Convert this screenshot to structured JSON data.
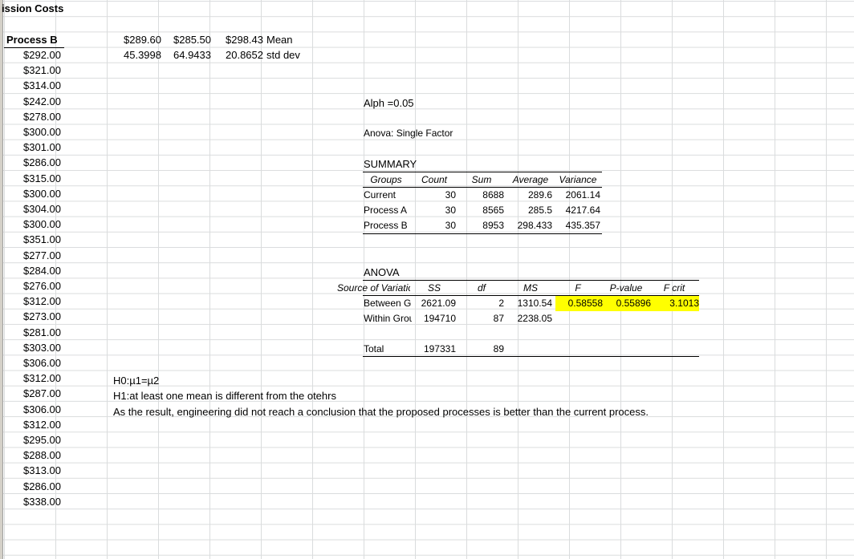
{
  "title": "ission Costs",
  "process_b": {
    "header": "Process B",
    "values": [
      "$292.00",
      "$321.00",
      "$314.00",
      "$242.00",
      "$278.00",
      "$300.00",
      "$301.00",
      "$286.00",
      "$315.00",
      "$300.00",
      "$304.00",
      "$300.00",
      "$351.00",
      "$277.00",
      "$284.00",
      "$276.00",
      "$312.00",
      "$273.00",
      "$281.00",
      "$303.00",
      "$306.00",
      "$312.00",
      "$287.00",
      "$306.00",
      "$312.00",
      "$295.00",
      "$288.00",
      "$313.00",
      "$286.00",
      "$338.00"
    ]
  },
  "stats": {
    "means": [
      "$289.60",
      "$285.50",
      "$298.43"
    ],
    "mean_label": "Mean",
    "stds": [
      "45.3998",
      "64.9433",
      "20.8652"
    ],
    "std_label": "std dev"
  },
  "alpha": "Alph =0.05",
  "anova_title": "Anova: Single Factor",
  "summary": {
    "label": "SUMMARY",
    "headers": [
      "Groups",
      "Count",
      "Sum",
      "Average",
      "Variance"
    ],
    "rows": [
      [
        "Current",
        "30",
        "8688",
        "289.6",
        "2061.14"
      ],
      [
        "Process A",
        "30",
        "8565",
        "285.5",
        "4217.64"
      ],
      [
        "Process B",
        "30",
        "8953",
        "298.433",
        "435.357"
      ]
    ]
  },
  "anova": {
    "label": "ANOVA",
    "headers": [
      "Source of Variation",
      "SS",
      "df",
      "MS",
      "F",
      "P-value",
      "F crit"
    ],
    "rows": [
      [
        "Between Groups",
        "2621.09",
        "2",
        "1310.54",
        "0.58558",
        "0.55896",
        "3.1013"
      ],
      [
        "Within Groups",
        "194710",
        "87",
        "2238.05",
        "",
        "",
        ""
      ]
    ],
    "total": [
      "Total",
      "197331",
      "89"
    ]
  },
  "hypothesis": {
    "h0": "H0:µ1=µ2",
    "h1": "H1:at least one mean is different from the otehrs",
    "conclusion": "As the result, engineering did not reach a conclusion that the proposed processes is better than the current process."
  },
  "colors": {
    "highlight": "#ffff00",
    "gridline": "#dadcdd"
  }
}
